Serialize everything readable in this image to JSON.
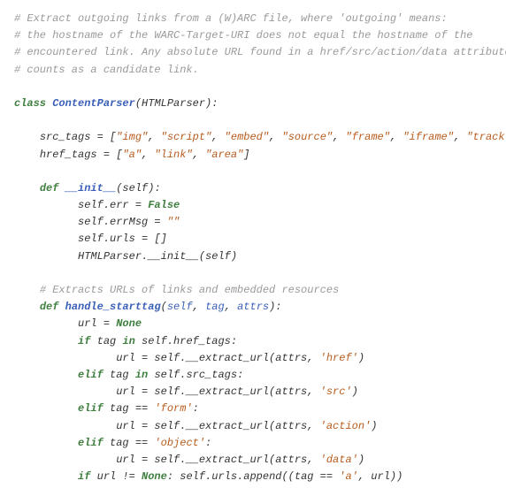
{
  "lines": [
    {
      "indent": 0,
      "tokens": [
        {
          "t": "cm",
          "v": "# Extract outgoing links from a (W)ARC file, where 'outgoing' means:"
        }
      ]
    },
    {
      "indent": 0,
      "tokens": [
        {
          "t": "cm",
          "v": "# the hostname of the WARC-Target-URI does not equal the hostname of the"
        }
      ]
    },
    {
      "indent": 0,
      "tokens": [
        {
          "t": "cm",
          "v": "# encountered link. Any absolute URL found in a href/src/action/data attribute"
        }
      ]
    },
    {
      "indent": 0,
      "tokens": [
        {
          "t": "cm",
          "v": "# counts as a candidate link."
        }
      ]
    },
    {
      "indent": 0,
      "tokens": []
    },
    {
      "indent": 0,
      "tokens": [
        {
          "t": "kw",
          "v": "class "
        },
        {
          "t": "cls",
          "v": "ContentParser"
        },
        {
          "t": "id",
          "v": "(HTMLParser):"
        }
      ]
    },
    {
      "indent": 0,
      "tokens": []
    },
    {
      "indent": 4,
      "tokens": [
        {
          "t": "id",
          "v": "src_tags = ["
        },
        {
          "t": "str",
          "v": "\"img\""
        },
        {
          "t": "id",
          "v": ", "
        },
        {
          "t": "str",
          "v": "\"script\""
        },
        {
          "t": "id",
          "v": ", "
        },
        {
          "t": "str",
          "v": "\"embed\""
        },
        {
          "t": "id",
          "v": ", "
        },
        {
          "t": "str",
          "v": "\"source\""
        },
        {
          "t": "id",
          "v": ", "
        },
        {
          "t": "str",
          "v": "\"frame\""
        },
        {
          "t": "id",
          "v": ", "
        },
        {
          "t": "str",
          "v": "\"iframe\""
        },
        {
          "t": "id",
          "v": ", "
        },
        {
          "t": "str",
          "v": "\"track\""
        },
        {
          "t": "id",
          "v": "]"
        }
      ]
    },
    {
      "indent": 4,
      "tokens": [
        {
          "t": "id",
          "v": "href_tags = ["
        },
        {
          "t": "str",
          "v": "\"a\""
        },
        {
          "t": "id",
          "v": ", "
        },
        {
          "t": "str",
          "v": "\"link\""
        },
        {
          "t": "id",
          "v": ", "
        },
        {
          "t": "str",
          "v": "\"area\""
        },
        {
          "t": "id",
          "v": "]"
        }
      ]
    },
    {
      "indent": 0,
      "tokens": []
    },
    {
      "indent": 4,
      "tokens": [
        {
          "t": "kw",
          "v": "def "
        },
        {
          "t": "fn",
          "v": "__init__"
        },
        {
          "t": "id",
          "v": "(self):"
        }
      ]
    },
    {
      "indent": 10,
      "tokens": [
        {
          "t": "id",
          "v": "self.err = "
        },
        {
          "t": "kw",
          "v": "False"
        }
      ]
    },
    {
      "indent": 10,
      "tokens": [
        {
          "t": "id",
          "v": "self.errMsg = "
        },
        {
          "t": "str",
          "v": "\"\""
        }
      ]
    },
    {
      "indent": 10,
      "tokens": [
        {
          "t": "id",
          "v": "self.urls = []"
        }
      ]
    },
    {
      "indent": 10,
      "tokens": [
        {
          "t": "id",
          "v": "HTMLParser.__init__(self)"
        }
      ]
    },
    {
      "indent": 0,
      "tokens": []
    },
    {
      "indent": 4,
      "tokens": [
        {
          "t": "cm",
          "v": "# Extracts URLs of links and embedded resources"
        }
      ]
    },
    {
      "indent": 4,
      "tokens": [
        {
          "t": "kw",
          "v": "def "
        },
        {
          "t": "fn",
          "v": "handle_starttag"
        },
        {
          "t": "id",
          "v": "("
        },
        {
          "t": "arg",
          "v": "self"
        },
        {
          "t": "id",
          "v": ", "
        },
        {
          "t": "arg",
          "v": "tag"
        },
        {
          "t": "id",
          "v": ", "
        },
        {
          "t": "arg",
          "v": "attrs"
        },
        {
          "t": "id",
          "v": "):"
        }
      ]
    },
    {
      "indent": 10,
      "tokens": [
        {
          "t": "id",
          "v": "url = "
        },
        {
          "t": "kw",
          "v": "None"
        }
      ]
    },
    {
      "indent": 10,
      "tokens": [
        {
          "t": "kw",
          "v": "if"
        },
        {
          "t": "id",
          "v": " tag "
        },
        {
          "t": "kw",
          "v": "in"
        },
        {
          "t": "id",
          "v": " self.href_tags:"
        }
      ]
    },
    {
      "indent": 16,
      "tokens": [
        {
          "t": "id",
          "v": "url = self.__extract_url(attrs, "
        },
        {
          "t": "str",
          "v": "'href'"
        },
        {
          "t": "id",
          "v": ")"
        }
      ]
    },
    {
      "indent": 10,
      "tokens": [
        {
          "t": "kw",
          "v": "elif"
        },
        {
          "t": "id",
          "v": " tag "
        },
        {
          "t": "kw",
          "v": "in"
        },
        {
          "t": "id",
          "v": " self.src_tags:"
        }
      ]
    },
    {
      "indent": 16,
      "tokens": [
        {
          "t": "id",
          "v": "url = self.__extract_url(attrs, "
        },
        {
          "t": "str",
          "v": "'src'"
        },
        {
          "t": "id",
          "v": ")"
        }
      ]
    },
    {
      "indent": 10,
      "tokens": [
        {
          "t": "kw",
          "v": "elif"
        },
        {
          "t": "id",
          "v": " tag == "
        },
        {
          "t": "str",
          "v": "'form'"
        },
        {
          "t": "id",
          "v": ":"
        }
      ]
    },
    {
      "indent": 16,
      "tokens": [
        {
          "t": "id",
          "v": "url = self.__extract_url(attrs, "
        },
        {
          "t": "str",
          "v": "'action'"
        },
        {
          "t": "id",
          "v": ")"
        }
      ]
    },
    {
      "indent": 10,
      "tokens": [
        {
          "t": "kw",
          "v": "elif"
        },
        {
          "t": "id",
          "v": " tag == "
        },
        {
          "t": "str",
          "v": "'object'"
        },
        {
          "t": "id",
          "v": ":"
        }
      ]
    },
    {
      "indent": 16,
      "tokens": [
        {
          "t": "id",
          "v": "url = self.__extract_url(attrs, "
        },
        {
          "t": "str",
          "v": "'data'"
        },
        {
          "t": "id",
          "v": ")"
        }
      ]
    },
    {
      "indent": 10,
      "tokens": [
        {
          "t": "kw",
          "v": "if"
        },
        {
          "t": "id",
          "v": " url != "
        },
        {
          "t": "kw",
          "v": "None"
        },
        {
          "t": "id",
          "v": ": self.urls.append((tag == "
        },
        {
          "t": "str",
          "v": "'a'"
        },
        {
          "t": "id",
          "v": ", url))"
        }
      ]
    }
  ]
}
